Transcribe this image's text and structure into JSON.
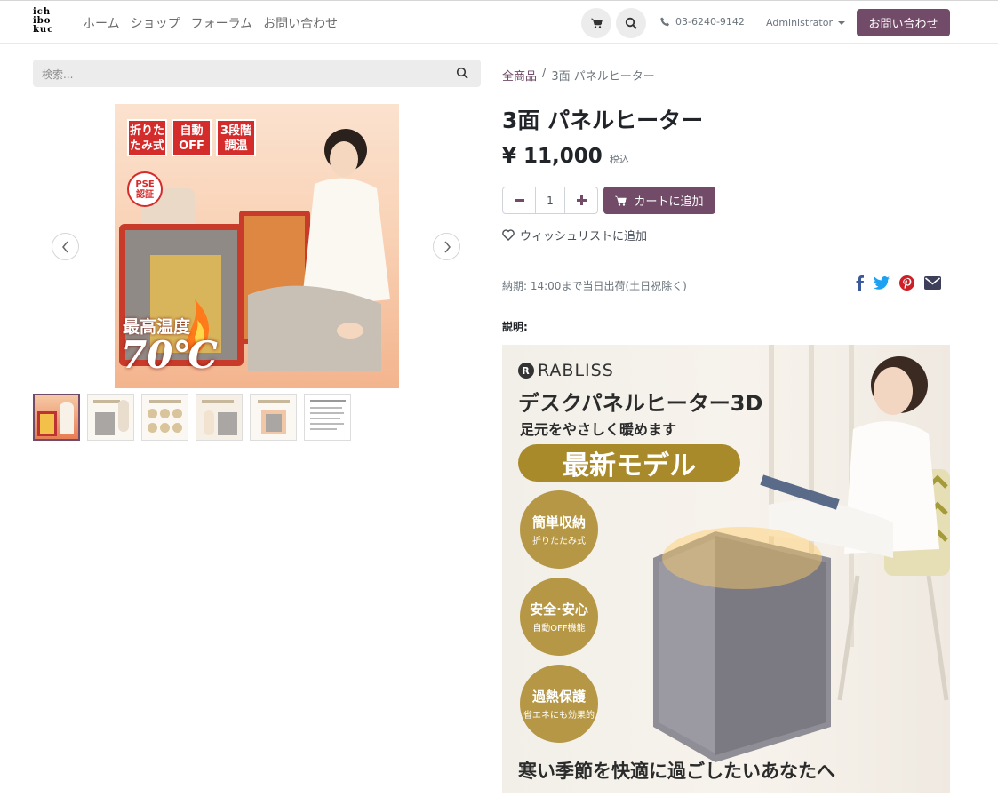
{
  "header": {
    "logo_lines": [
      "ich",
      "ibo",
      "kuc"
    ],
    "nav": [
      "ホーム",
      "ショップ",
      "フォーラム",
      "お問い合わせ"
    ],
    "icons": [
      "cart-icon",
      "search-icon"
    ],
    "phone": "03-6240-9142",
    "user": "Administrator",
    "contact_button": "お問い合わせ"
  },
  "search": {
    "placeholder": "検索..."
  },
  "gallery": {
    "main_image_text": {
      "tags": [
        "折りた\nたみ式",
        "自動\nOFF",
        "3段階\n調温"
      ],
      "pse": "PSE\n認証",
      "temp_label": "最高温度",
      "temp_value": "70℃"
    },
    "thumbnail_count": 6
  },
  "product": {
    "breadcrumb": [
      "全商品",
      "3面 パネルヒーター"
    ],
    "title": "3面 パネルヒーター",
    "price": "¥ 11,000",
    "tax_note": "税込",
    "quantity": "1",
    "add_to_cart": "カートに追加",
    "wishlist": "ウィッシュリストに追加",
    "delivery": "納期: 14:00まで当日出荷(土日祝除く)",
    "share_icons": [
      "facebook-icon",
      "twitter-icon",
      "pinterest-icon",
      "email-icon"
    ],
    "description_label": "説明:"
  },
  "description_image": {
    "brand": "RABLISS",
    "heading": "デスクパネルヒーター3D",
    "subheading": "足元をやさしく暖めます",
    "pill": "最新モデル",
    "badges": [
      {
        "title": "簡単収納",
        "sub": "折りたたみ式"
      },
      {
        "title": "安全·安心",
        "sub": "自動OFF機能"
      },
      {
        "title": "過熱保護",
        "sub": "省エネにも効果的"
      }
    ],
    "footer": "寒い季節を快適に過ごしたいあなたへ"
  },
  "colors": {
    "primary": "#714b67",
    "gold": "#b59745",
    "facebook": "#3b5998",
    "twitter": "#1da1f2",
    "pinterest": "#cb2027"
  }
}
